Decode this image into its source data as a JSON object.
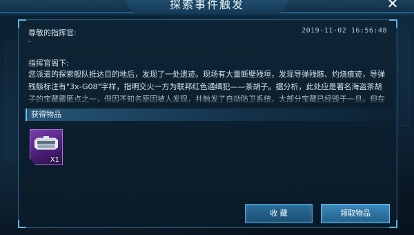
{
  "window": {
    "title": "探索事件触发",
    "close_glyph": "✕"
  },
  "message": {
    "greeting": "尊敬的指挥官:",
    "timestamp": "2019-11-02 16:56:48",
    "dash": "-",
    "salutation": "指挥官阁下:",
    "body": "您派遣的探索舰队抵达目的地后，发现了一处遗迹。现场有大量断壁残垣，发现导弹残骸、灼烧痕迹，导弹残骸标注有\"3x-G08\"字样，指明交火一方为联邦红色通缉犯——茶胡子。据分析，此处应是著名海盗茶胡子的宝藏藏匿点之一，但因不知名原因被人发现，并触发了自动防卫系统，大部分宝藏已经毁于一旦。但在该遗迹依然检索到以下可用物资，请指挥官阁下查收"
  },
  "rewards": {
    "header": "获得物品",
    "items": [
      {
        "icon": "supply-crate-icon",
        "quantity": "X1",
        "rarity_color": "#7a3fb0"
      }
    ]
  },
  "actions": {
    "collect_label": "收 藏",
    "claim_label": "领取物品"
  },
  "colors": {
    "accent": "#4aa8dc",
    "panel": "#0e2434",
    "text": "#d6e2ea"
  }
}
